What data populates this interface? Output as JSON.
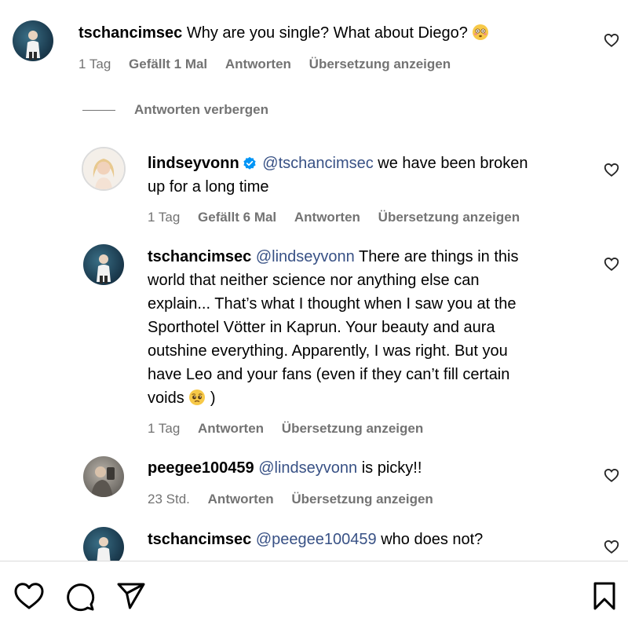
{
  "comments": [
    {
      "username": "tschancimsec",
      "text": "Why are you single? What about Diego?",
      "emoji": "flushed-face",
      "time": "1 Tag",
      "likes": "Gefällt 1 Mal",
      "reply": "Antworten",
      "translate": "Übersetzung anzeigen"
    },
    {
      "username": "lindseyvonn",
      "verified": true,
      "mention": "@tschancimsec",
      "text_line1": "we have been broken",
      "text_line2": "up for a long time",
      "time": "1 Tag",
      "likes": "Gefällt 6 Mal",
      "reply": "Antworten",
      "translate": "Übersetzung anzeigen"
    },
    {
      "username": "tschancimsec",
      "mention": "@lindseyvonn",
      "line1": "There are things in this",
      "line2": "world that neither science nor anything else can",
      "line3": "explain... That’s what I thought when I saw you at the",
      "line4": "Sporthotel Vötter in Kaprun. Your beauty and aura",
      "line5": "outshine everything. Apparently, I was right. But you",
      "line6": "have Leo and your fans (even if they can’t fill certain",
      "line7_before": "voids",
      "line7_after": ")",
      "emoji": "pleading-face",
      "time": "1 Tag",
      "reply": "Antworten",
      "translate": "Übersetzung anzeigen"
    },
    {
      "username": "peegee100459",
      "mention": "@lindseyvonn",
      "text": "is picky!!",
      "time": "23 Std.",
      "reply": "Antworten",
      "translate": "Übersetzung anzeigen"
    },
    {
      "username": "tschancimsec",
      "mention": "@peegee100459",
      "text": "who does not?"
    }
  ],
  "hide_replies": "Antworten verbergen",
  "colors": {
    "text": "#000000",
    "meta": "#737373",
    "mention": "#385185",
    "verified": "#0095f6"
  },
  "icons": {
    "like_comment": "heart-outline-icon",
    "bottom": [
      "heart-icon",
      "comment-icon",
      "share-icon",
      "bookmark-icon"
    ]
  }
}
